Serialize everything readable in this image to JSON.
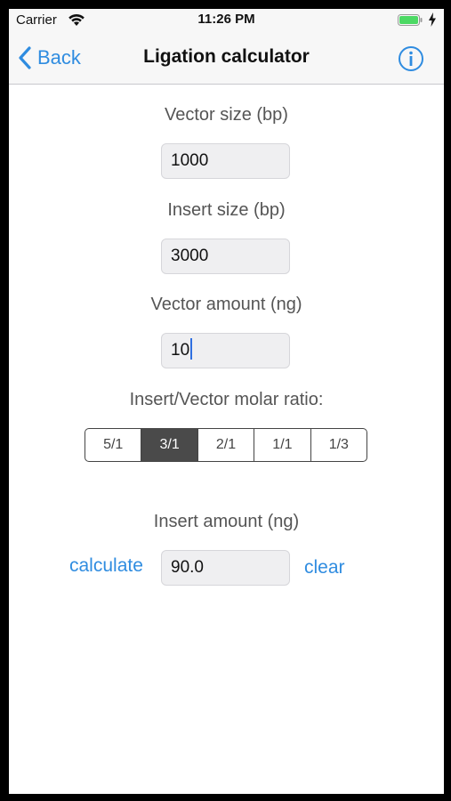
{
  "status_bar": {
    "carrier": "Carrier",
    "time": "11:26 PM",
    "battery_color": "#4cd964"
  },
  "nav": {
    "back_label": "Back",
    "title": "Ligation calculator",
    "accent_color": "#2f8ce0"
  },
  "form": {
    "vector_size_label": "Vector size (bp)",
    "vector_size_value": "1000",
    "insert_size_label": "Insert size (bp)",
    "insert_size_value": "3000",
    "vector_amount_label": "Vector amount (ng)",
    "vector_amount_value": "10",
    "ratio_label": "Insert/Vector molar ratio:",
    "ratio_options": [
      "5/1",
      "3/1",
      "2/1",
      "1/1",
      "1/3"
    ],
    "ratio_selected": "3/1",
    "insert_amount_label": "Insert amount (ng)",
    "insert_amount_value": "90.0",
    "calculate_label": "calculate",
    "clear_label": "clear"
  }
}
